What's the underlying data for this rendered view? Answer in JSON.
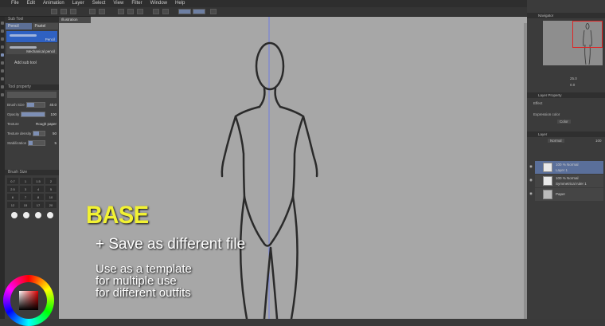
{
  "menu": [
    "File",
    "Edit",
    "Animation",
    "Layer",
    "Select",
    "View",
    "Filter",
    "Window",
    "Help"
  ],
  "left_panel": {
    "subtool_header": "Sub Tool",
    "tabs": [
      "Pencil",
      "Pastel"
    ],
    "brushes": [
      "Pencil",
      "Mechanical pencil"
    ],
    "add_subtool": "Add sub tool",
    "tool_property_header": "Tool property",
    "props": [
      {
        "label": "Brush Size",
        "value": "40.0"
      },
      {
        "label": "Opacity",
        "value": "100"
      },
      {
        "label": "Texture",
        "value": "Rough paper"
      },
      {
        "label": "Texture density",
        "value": "50"
      },
      {
        "label": "Stabilization",
        "value": "5"
      }
    ],
    "brush_size_header": "Brush Size",
    "sizes": [
      "0.7",
      "1",
      "1.5",
      "2",
      "2.5",
      "3",
      "4",
      "5",
      "6",
      "7",
      "8",
      "10",
      "12",
      "15",
      "17",
      "20"
    ]
  },
  "canvas": {
    "tab_label": "Illustration"
  },
  "right_panel": {
    "navigator_header": "Navigator",
    "zoom": "25.0",
    "rotation": "0.0",
    "layer_property_header": "Layer Property",
    "effect_label": "Effect",
    "expression_color_label": "Expression color",
    "expression_color_value": "Color",
    "layer_header": "Layer",
    "blend_mode": "Normal",
    "opacity": "100",
    "layers": [
      {
        "line1": "100 % Normal",
        "line2": "Layer 1",
        "selected": true
      },
      {
        "line1": "100 % Normal",
        "line2": "Symmetrical ruler 1",
        "selected": false
      },
      {
        "line1": "",
        "line2": "Paper",
        "selected": false
      }
    ]
  },
  "overlay": {
    "base": "BASE",
    "save": "+ Save as different file",
    "use_lines": [
      "Use as a template",
      "for multiple use",
      "for different outfits"
    ]
  },
  "colors": {
    "accent_blue": "#2f61c2",
    "overlay_yellow": "#f2f233",
    "navigator_frame": "#e02424"
  }
}
